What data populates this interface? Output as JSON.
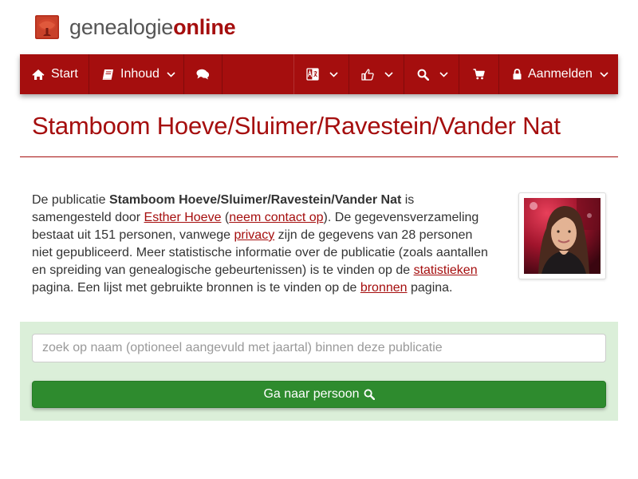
{
  "brand": {
    "name_part1": "genealogie",
    "name_part2": "online",
    "logo_icon": "tree-icon",
    "color_primary": "#a50e0e"
  },
  "navbar": {
    "start": {
      "label": "Start",
      "icon": "home-icon"
    },
    "inhoud": {
      "label": "Inhoud",
      "icon": "book-icon"
    },
    "chat": {
      "icon": "comments-icon"
    },
    "language": {
      "icon": "language-icon"
    },
    "like": {
      "icon": "thumbs-up-icon"
    },
    "search": {
      "icon": "search-icon"
    },
    "cart": {
      "icon": "cart-icon"
    },
    "login": {
      "label": "Aanmelden",
      "icon": "lock-icon"
    }
  },
  "page": {
    "title": "Stamboom Hoeve/Sluimer/Ravestein/Vander Nat"
  },
  "intro": {
    "t1": "De publicatie ",
    "pub_name": "Stamboom Hoeve/Sluimer/Ravestein/Vander Nat",
    "t2": " is samengesteld door ",
    "author_link": "Esther Hoeve",
    "t3": " (",
    "contact_link": "neem contact op",
    "t4": "). De gegevensverzameling bestaat uit 151 personen, vanwege ",
    "privacy_link": "privacy",
    "t5": " zijn de gegevens van 28 personen niet gepubliceerd. Meer statistische informatie over de publicatie (zoals aantallen en spreiding van genealogische gebeurtenissen) is te vinden op de ",
    "stats_link": "statistieken",
    "t6": " pagina. Een lijst met gebruikte bronnen is te vinden op de ",
    "sources_link": "bronnen",
    "t7": " pagina."
  },
  "search": {
    "placeholder": "zoek op naam (optioneel aangevuld met jaartal) binnen deze publicatie",
    "value": "",
    "button_label": "Ga naar persoon",
    "button_icon": "search-icon",
    "panel_color": "#dbefd9",
    "button_color": "#2e8b2e"
  }
}
